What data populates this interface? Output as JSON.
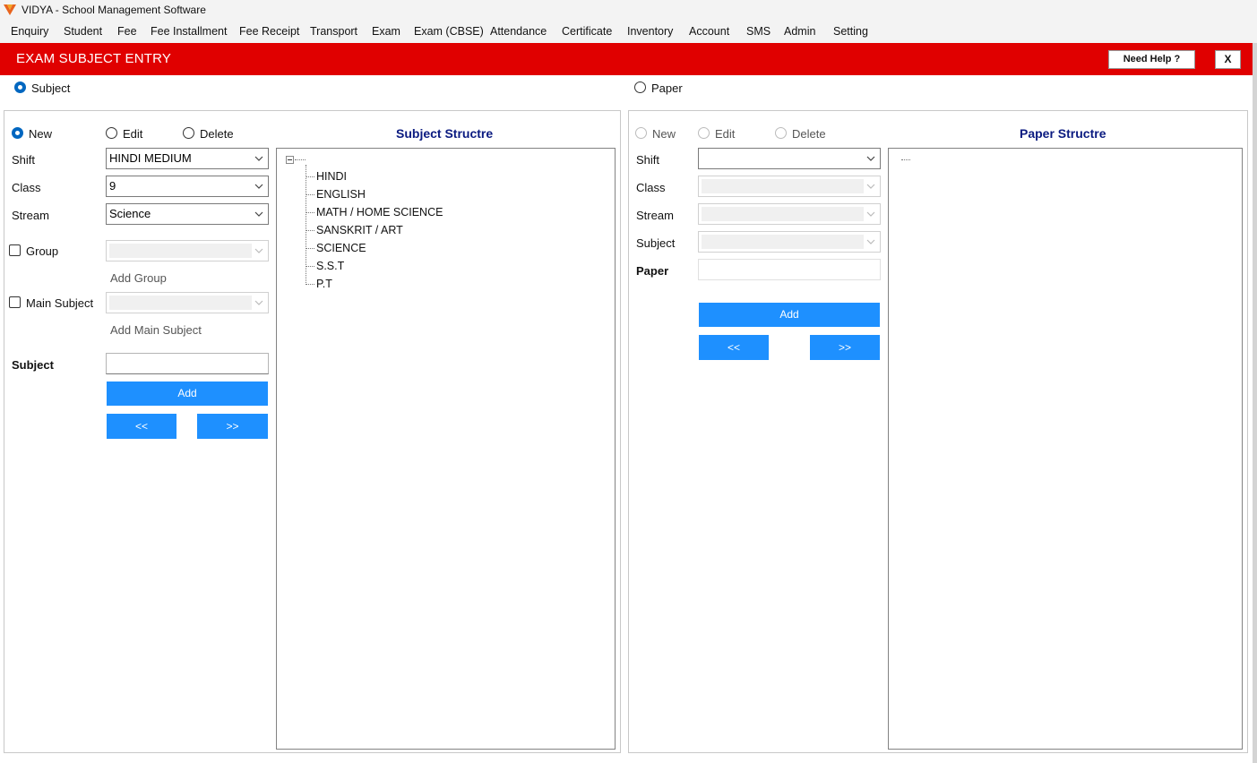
{
  "window": {
    "title": "VIDYA - School Management Software"
  },
  "menu": [
    "Enquiry",
    "Student",
    "Fee",
    "Fee Installment",
    "Fee Receipt",
    "Transport",
    "Exam",
    "Exam (CBSE)",
    "Attendance",
    "Certificate",
    "Inventory",
    "Account",
    "SMS",
    "Admin",
    "Setting"
  ],
  "header": {
    "title": "EXAM SUBJECT ENTRY",
    "help_label": "Need Help ?",
    "close_label": "X",
    "color": "#e00000"
  },
  "mode": {
    "subject_label": "Subject",
    "paper_label": "Paper",
    "selected": "Subject"
  },
  "subject_panel": {
    "actions": {
      "new": "New",
      "edit": "Edit",
      "delete": "Delete",
      "selected": "New"
    },
    "shift": {
      "label": "Shift",
      "value": "HINDI MEDIUM"
    },
    "class": {
      "label": "Class",
      "value": "9"
    },
    "stream": {
      "label": "Stream",
      "value": "Science"
    },
    "group": {
      "label": "Group",
      "checked": false,
      "value": ""
    },
    "add_group_label": "Add Group",
    "main_subject": {
      "label": "Main Subject",
      "checked": false,
      "value": ""
    },
    "add_main_subject_label": "Add Main Subject",
    "subject": {
      "label": "Subject",
      "value": ""
    },
    "add_button": "Add",
    "prev_button": "<<",
    "next_button": ">>",
    "structure_title": "Subject Structre",
    "tree_items": [
      "HINDI",
      "ENGLISH",
      "MATH / HOME SCIENCE",
      "SANSKRIT / ART",
      "SCIENCE",
      "S.S.T",
      "P.T"
    ]
  },
  "paper_panel": {
    "actions": {
      "new": "New",
      "edit": "Edit",
      "delete": "Delete"
    },
    "shift": {
      "label": "Shift",
      "value": ""
    },
    "class": {
      "label": "Class",
      "value": ""
    },
    "stream": {
      "label": "Stream",
      "value": ""
    },
    "subject": {
      "label": "Subject",
      "value": ""
    },
    "paper": {
      "label": "Paper",
      "value": ""
    },
    "add_button": "Add",
    "prev_button": "<<",
    "next_button": ">>",
    "structure_title": "Paper Structre"
  },
  "colors": {
    "accent": "#1e90ff",
    "title_text": "#0a1a80",
    "header_bg": "#e00000"
  }
}
